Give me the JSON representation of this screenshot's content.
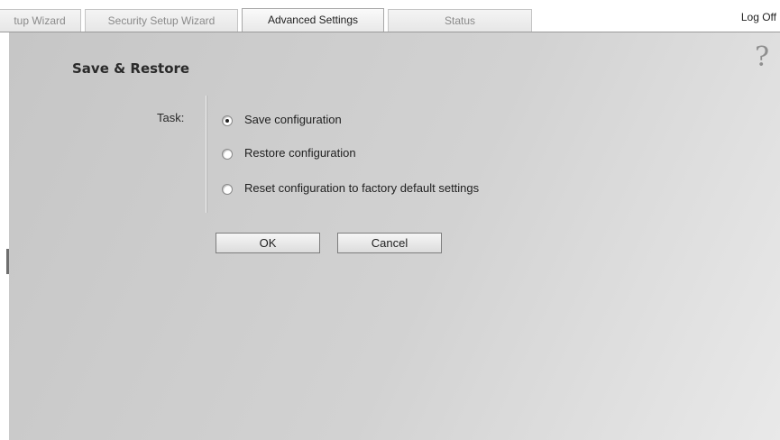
{
  "tabs": [
    {
      "label": "tup Wizard",
      "active": false
    },
    {
      "label": "Security Setup Wizard",
      "active": false
    },
    {
      "label": "Advanced Settings",
      "active": true
    },
    {
      "label": "Status",
      "active": false
    }
  ],
  "header": {
    "logoff_label": "Log Off",
    "help_symbol": "?"
  },
  "page": {
    "title": "Save & Restore"
  },
  "form": {
    "task_label": "Task:",
    "options": [
      {
        "label": "Save configuration",
        "checked": true
      },
      {
        "label": "Restore configuration",
        "checked": false
      },
      {
        "label": "Reset configuration to factory default settings",
        "checked": false
      }
    ],
    "ok_label": "OK",
    "cancel_label": "Cancel"
  }
}
